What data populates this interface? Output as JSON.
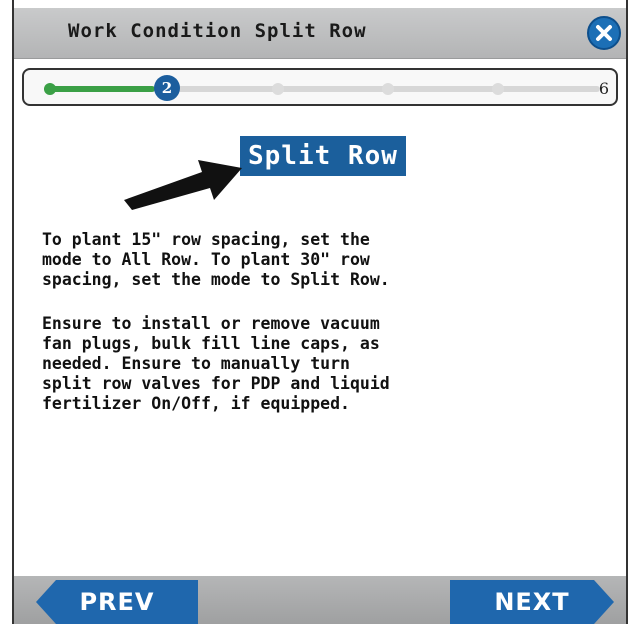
{
  "header": {
    "title": "Work Condition Split Row",
    "close_icon": "close-icon"
  },
  "progress": {
    "current_step": "2",
    "total_steps": "6",
    "fraction_complete": 0.2,
    "color_done": "#3ba046",
    "color_current": "#1c5e9e"
  },
  "main": {
    "heading": "Split Row",
    "pointer_icon": "arrow-right-icon",
    "paragraph1_lines": [
      "To plant 15\" row spacing, set the",
      "mode to All Row. To plant 30\" row",
      "spacing, set the mode to Split Row."
    ],
    "paragraph2_lines": [
      "Ensure to install or remove vacuum",
      "fan plugs, bulk fill line caps, as",
      "needed. Ensure to manually turn",
      "split row valves for PDP and liquid",
      "fertilizer On/Off, if equipped."
    ]
  },
  "footer": {
    "prev_label": "PREV",
    "next_label": "NEXT",
    "button_color": "#1f67ad"
  }
}
